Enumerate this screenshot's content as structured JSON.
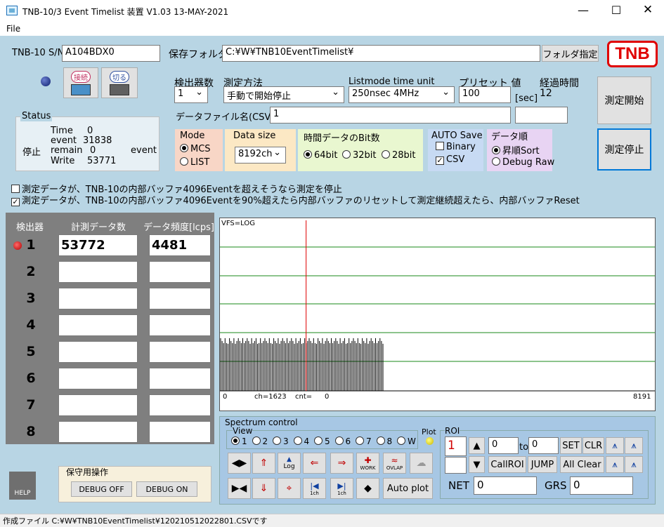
{
  "window": {
    "title": "TNB-10/3 Event Timelist 装置  V1.03 13-MAY-2021"
  },
  "menu": {
    "file": "File"
  },
  "header": {
    "sn_label": "TNB-10 S/N",
    "sn_value": "A104BDX0",
    "folder_label": "保存フォルダ",
    "folder_value": "C:¥W¥TNB10EventTimelist¥",
    "folder_button": "フォルダ指定",
    "logo": "TNB"
  },
  "conn": {
    "connect": "接続",
    "disconnect": "切る"
  },
  "settings": {
    "detectors_label": "検出器数",
    "detectors_value": "1",
    "method_label": "測定方法",
    "method_value": "手動で開始停止",
    "unit_label": "Listmode time unit",
    "unit_value": "250nsec   4MHz",
    "preset_label": "プリセット 値",
    "preset_value": "100",
    "sec_label": "[sec]",
    "elapsed_label": "経過時間",
    "elapsed_value": "12",
    "file_label": "データファイル名(CSV)",
    "file_value": "1",
    "extra_value": ""
  },
  "actions": {
    "start": "測定開始",
    "stop": "測定停止"
  },
  "status": {
    "title": "Status",
    "state": "停止",
    "time_label": "Time",
    "time_value": "0",
    "event_label": "event",
    "event_value": "31838",
    "remain_label": "remain",
    "remain_value": "0",
    "remain_unit": "event",
    "write_label": "Write",
    "write_value": "53771"
  },
  "mode": {
    "title": "Mode",
    "mcs": "MCS",
    "list": "LIST"
  },
  "datasize": {
    "title": "Data size",
    "value": "8192ch"
  },
  "bits": {
    "title": "時間データのBit数",
    "b64": "64bit",
    "b32": "32bit",
    "b28": "28bit"
  },
  "autosave": {
    "title": "AUTO Save",
    "binary": "Binary",
    "csv": "CSV"
  },
  "order": {
    "title": "データ順",
    "sort": "昇順Sort",
    "raw": "Debug Raw"
  },
  "options": {
    "opt1": "測定データが、TNB-10の内部バッファ4096Eventを超えそうなら測定を停止",
    "opt2": "測定データが、TNB-10の内部バッファ4096Eventを90%超えたら内部バッファのリセットして測定継続超えたら、内部バッファReset"
  },
  "table": {
    "col_detector": "検出器",
    "col_count": "計測データ数",
    "col_rate": "データ頻度[lcps]",
    "rows": [
      {
        "num": "1",
        "count": "53772",
        "rate": "4481"
      },
      {
        "num": "2",
        "count": "",
        "rate": ""
      },
      {
        "num": "3",
        "count": "",
        "rate": ""
      },
      {
        "num": "4",
        "count": "",
        "rate": ""
      },
      {
        "num": "5",
        "count": "",
        "rate": ""
      },
      {
        "num": "6",
        "count": "",
        "rate": ""
      },
      {
        "num": "7",
        "count": "",
        "rate": ""
      },
      {
        "num": "8",
        "count": "",
        "rate": ""
      }
    ]
  },
  "maint": {
    "title": "保守用操作",
    "debug_off": "DEBUG OFF",
    "debug_on": "DEBUG ON",
    "help": "HELP"
  },
  "plot": {
    "vfs": "VFS=LOG",
    "ch_start": "0",
    "ch_info": "ch=1623",
    "cnt_info": "cnt=",
    "cnt_value": "0",
    "ch_end": "8191",
    "cursor_ch": 1623,
    "max_ch": 8191,
    "data_end_ch": 3070,
    "log_level_fraction": 0.285
  },
  "spectrum": {
    "title": "Spectrum control",
    "view_label": "View",
    "views": [
      "1",
      "2",
      "3",
      "4",
      "5",
      "6",
      "7",
      "8",
      "W"
    ],
    "plot_label": "Plot",
    "autoplot": "Auto plot",
    "btn_log": "Log",
    "btn_work": "WORK",
    "btn_ovlap": "OVLAP",
    "btn_1ch_a": "1ch",
    "btn_1ch_b": "1ch"
  },
  "roi": {
    "title": "ROI",
    "number": "1",
    "from": "0",
    "to_label": "to",
    "to": "0",
    "set": "SET",
    "clr": "CLR",
    "callroi": "CallROI",
    "jump": "JUMP",
    "allclear": "All Clear",
    "net_label": "NET",
    "net_value": "0",
    "grs_label": "GRS",
    "grs_value": "0"
  },
  "statusbar": {
    "text": "作成ファイル C:¥W¥TNB10EventTimelist¥120210512022801.CSVです"
  }
}
